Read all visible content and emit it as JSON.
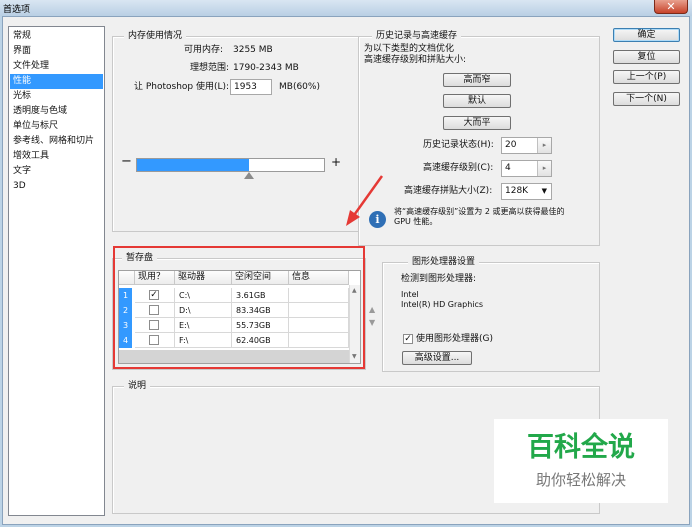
{
  "window": {
    "title": "首选项",
    "close_glyph": "✕"
  },
  "categories": [
    {
      "label": "常规",
      "selected": false
    },
    {
      "label": "界面",
      "selected": false
    },
    {
      "label": "文件处理",
      "selected": false
    },
    {
      "label": "性能",
      "selected": true
    },
    {
      "label": "光标",
      "selected": false
    },
    {
      "label": "透明度与色域",
      "selected": false
    },
    {
      "label": "单位与标尺",
      "selected": false
    },
    {
      "label": "参考线、网格和切片",
      "selected": false
    },
    {
      "label": "增效工具",
      "selected": false
    },
    {
      "label": "文字",
      "selected": false
    },
    {
      "label": "3D",
      "selected": false
    }
  ],
  "memory": {
    "legend": "内存使用情况",
    "available_label": "可用内存:",
    "available_value": "3255 MB",
    "ideal_label": "理想范围:",
    "ideal_value": "1790-2343 MB",
    "usage_label": "让 Photoshop 使用(L):",
    "usage_value": "1953",
    "usage_unit": "MB(60%)",
    "minus": "−",
    "plus": "+",
    "slider_fraction": 0.6
  },
  "history": {
    "legend": "历史记录与高速缓存",
    "desc_line1": "为以下类型的文档优化",
    "desc_line2": "高速缓存级别和拼贴大小:",
    "btn_tall": "高而窄",
    "btn_default": "默认",
    "btn_big": "大而平",
    "states_label": "历史记录状态(H):",
    "states_value": "20",
    "cache_levels_label": "高速缓存级别(C):",
    "cache_levels_value": "4",
    "tile_size_label": "高速缓存拼贴大小(Z):",
    "tile_size_value": "128K",
    "info_line1": "将“高速缓存级别”设置为 2 或更高以获得最佳的",
    "info_line2": "GPU 性能。",
    "spin_glyph": "▸",
    "dropdown_glyph": "▼"
  },
  "scratch": {
    "legend": "暂存盘",
    "headers": [
      "现用？",
      "驱动器",
      "空闲空间",
      "信息"
    ],
    "rows": [
      {
        "num": "1",
        "checked": "✓",
        "drive": "C:\\",
        "free": "3.61GB",
        "info": ""
      },
      {
        "num": "2",
        "checked": "",
        "drive": "D:\\",
        "free": "83.34GB",
        "info": ""
      },
      {
        "num": "3",
        "checked": "",
        "drive": "E:\\",
        "free": "55.73GB",
        "info": ""
      },
      {
        "num": "4",
        "checked": "",
        "drive": "F:\\",
        "free": "62.40GB",
        "info": ""
      }
    ],
    "up_glyph": "▲",
    "down_glyph": "▼"
  },
  "gpu": {
    "legend": "图形处理器设置",
    "detected_label": "检测到图形处理器:",
    "vendor": "Intel",
    "model": "Intel(R) HD Graphics",
    "use_gpu_label": "使用图形处理器(G)",
    "use_gpu_check": "✓",
    "advanced_button": "高级设置..."
  },
  "description": {
    "legend": "说明"
  },
  "buttons": {
    "ok": "确定",
    "reset": "复位",
    "prev": "上一个(P)",
    "next": "下一个(N)"
  },
  "watermark": {
    "title": "百科全说",
    "subtitle": "助你轻松解决"
  },
  "colors": {
    "selection": "#3399ff",
    "highlight": "#e53935",
    "watermark_green": "#22a84a",
    "info_icon": "#2f6fb5"
  }
}
